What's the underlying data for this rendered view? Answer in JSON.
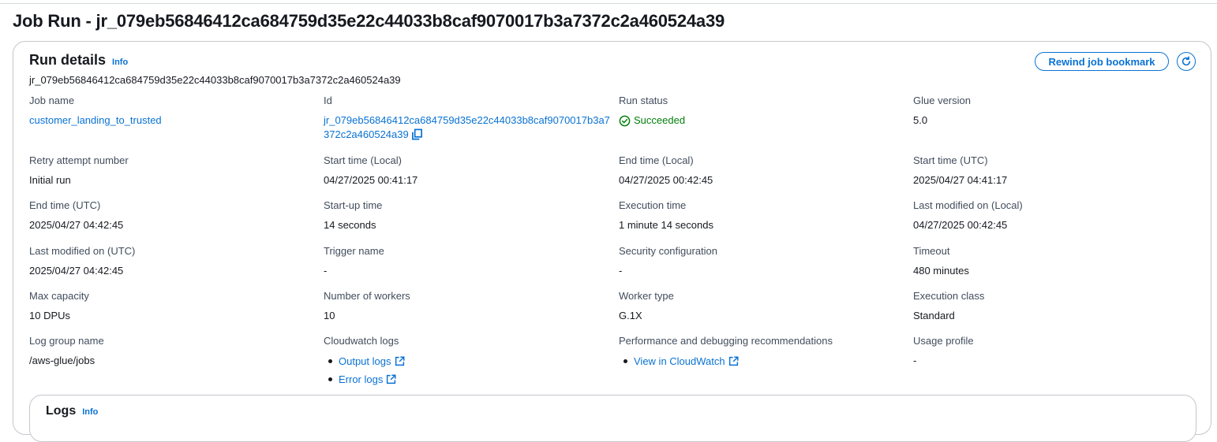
{
  "page": {
    "title": "Job Run - jr_079eb56846412ca684759d35e22c44033b8caf9070017b3a7372c2a460524a39"
  },
  "run_details": {
    "title": "Run details",
    "info_label": "Info",
    "run_id": "jr_079eb56846412ca684759d35e22c44033b8caf9070017b3a7372c2a460524a39",
    "rewind_button_label": "Rewind job bookmark",
    "fields": {
      "job_name": {
        "label": "Job name",
        "value": "customer_landing_to_trusted"
      },
      "id": {
        "label": "Id",
        "value": "jr_079eb56846412ca684759d35e22c44033b8caf9070017b3a7372c2a460524a39"
      },
      "run_status": {
        "label": "Run status",
        "value": "Succeeded"
      },
      "glue_version": {
        "label": "Glue version",
        "value": "5.0"
      },
      "retry_attempt": {
        "label": "Retry attempt number",
        "value": "Initial run"
      },
      "start_time_local": {
        "label": "Start time (Local)",
        "value": "04/27/2025 00:41:17"
      },
      "end_time_local": {
        "label": "End time (Local)",
        "value": "04/27/2025 00:42:45"
      },
      "start_time_utc": {
        "label": "Start time (UTC)",
        "value": "2025/04/27 04:41:17"
      },
      "end_time_utc": {
        "label": "End time (UTC)",
        "value": "2025/04/27 04:42:45"
      },
      "startup_time": {
        "label": "Start-up time",
        "value": "14 seconds"
      },
      "execution_time": {
        "label": "Execution time",
        "value": "1 minute 14 seconds"
      },
      "last_modified_local": {
        "label": "Last modified on (Local)",
        "value": "04/27/2025 00:42:45"
      },
      "last_modified_utc": {
        "label": "Last modified on (UTC)",
        "value": "2025/04/27 04:42:45"
      },
      "trigger_name": {
        "label": "Trigger name",
        "value": "-"
      },
      "security_configuration": {
        "label": "Security configuration",
        "value": "-"
      },
      "timeout": {
        "label": "Timeout",
        "value": "480 minutes"
      },
      "max_capacity": {
        "label": "Max capacity",
        "value": "10 DPUs"
      },
      "number_of_workers": {
        "label": "Number of workers",
        "value": "10"
      },
      "worker_type": {
        "label": "Worker type",
        "value": "G.1X"
      },
      "execution_class": {
        "label": "Execution class",
        "value": "Standard"
      },
      "log_group_name": {
        "label": "Log group name",
        "value": "/aws-glue/jobs"
      },
      "cloudwatch_logs": {
        "label": "Cloudwatch logs",
        "links": [
          "Output logs",
          "Error logs"
        ]
      },
      "perf_recommendations": {
        "label": "Performance and debugging recommendations",
        "links": [
          "View in CloudWatch"
        ]
      },
      "usage_profile": {
        "label": "Usage profile",
        "value": "-"
      }
    }
  },
  "logs": {
    "title": "Logs",
    "info_label": "Info"
  },
  "colors": {
    "link": "#0972d3",
    "success": "#037f0c",
    "border": "#c6c6cd",
    "text": "#16191f",
    "label": "#414d5c"
  },
  "icons": [
    "copy-icon",
    "check-circle-icon",
    "external-link-icon",
    "refresh-icon"
  ]
}
